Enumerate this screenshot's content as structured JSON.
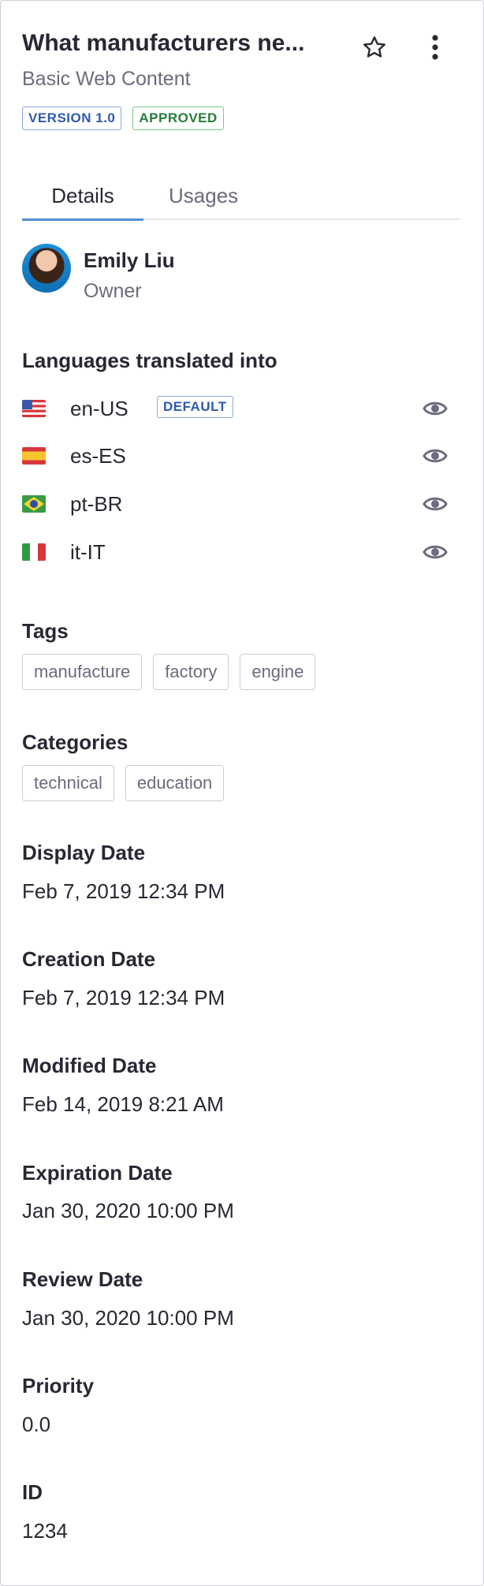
{
  "header": {
    "title": "What manufacturers ne...",
    "subtitle": "Basic Web Content",
    "badges": {
      "version": "VERSION 1.0",
      "status": "APPROVED"
    },
    "icons": {
      "favorite": "star-icon",
      "options": "kebab-icon"
    }
  },
  "tabs": [
    {
      "label": "Details",
      "active": true
    },
    {
      "label": "Usages",
      "active": false
    }
  ],
  "owner": {
    "name": "Emily Liu",
    "role": "Owner"
  },
  "languages": {
    "title": "Languages translated into",
    "default_label": "DEFAULT",
    "items": [
      {
        "code": "en-US",
        "flag": "us-flag-icon",
        "default": true
      },
      {
        "code": "es-ES",
        "flag": "es-flag-icon",
        "default": false
      },
      {
        "code": "pt-BR",
        "flag": "br-flag-icon",
        "default": false
      },
      {
        "code": "it-IT",
        "flag": "it-flag-icon",
        "default": false
      }
    ]
  },
  "tags": {
    "title": "Tags",
    "items": [
      "manufacture",
      "factory",
      "engine"
    ]
  },
  "categories": {
    "title": "Categories",
    "items": [
      "technical",
      "education"
    ]
  },
  "fields": {
    "display_date": {
      "label": "Display Date",
      "value": "Feb 7, 2019 12:34 PM"
    },
    "creation_date": {
      "label": "Creation Date",
      "value": "Feb 7, 2019 12:34 PM"
    },
    "modified_date": {
      "label": "Modified Date",
      "value": "Feb 14, 2019 8:21 AM"
    },
    "expiration_date": {
      "label": "Expiration Date",
      "value": "Jan 30, 2020 10:00 PM"
    },
    "review_date": {
      "label": "Review Date",
      "value": "Jan 30, 2020 10:00 PM"
    },
    "priority": {
      "label": "Priority",
      "value": "0.0"
    },
    "id": {
      "label": "ID",
      "value": "1234"
    }
  },
  "colors": {
    "accent": "#528ed3",
    "version_badge": "#2e5aac",
    "approved_badge": "#287d3c",
    "muted_text": "#6b6c7e"
  }
}
